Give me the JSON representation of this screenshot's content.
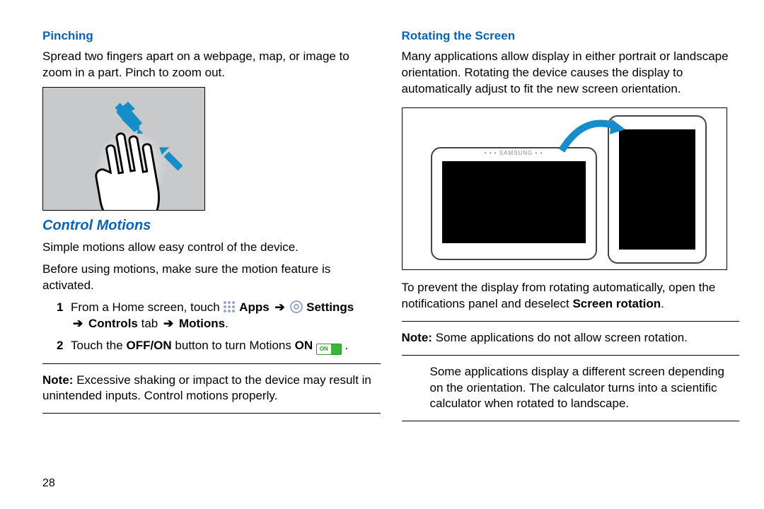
{
  "page_number": "28",
  "left": {
    "pinching": {
      "heading": "Pinching",
      "body": "Spread two fingers apart on a webpage, map, or image to zoom in a part. Pinch to zoom out."
    },
    "control_motions": {
      "heading": "Control Motions",
      "intro1": "Simple motions allow easy control of the device.",
      "intro2": "Before using motions, make sure the motion feature is activated.",
      "step1_pre": "From a Home screen, touch",
      "step1_apps": "Apps",
      "step1_settings": "Settings",
      "step1_controls": "Controls",
      "step1_tab": "tab",
      "step1_motions": "Motions",
      "step2_pre": "Touch the",
      "step2_offon": "OFF/ON",
      "step2_mid": "button to turn Motions",
      "step2_on": "ON",
      "note_label": "Note:",
      "note_text": "Excessive shaking or impact to the device may result in unintended inputs. Control motions properly."
    }
  },
  "right": {
    "rotating": {
      "heading": "Rotating the Screen",
      "body": "Many applications allow display in either portrait or landscape orientation. Rotating the device causes the display to automatically adjust to fit the new screen orientation.",
      "prevent_pre": "To prevent the display from rotating automatically, open the notifications panel and deselect",
      "prevent_bold": "Screen rotation",
      "note_label": "Note:",
      "note_text": "Some applications do not allow screen rotation.",
      "extra": "Some applications display a different screen depending on the orientation. The calculator turns into a scientific calculator when rotated to landscape."
    }
  }
}
